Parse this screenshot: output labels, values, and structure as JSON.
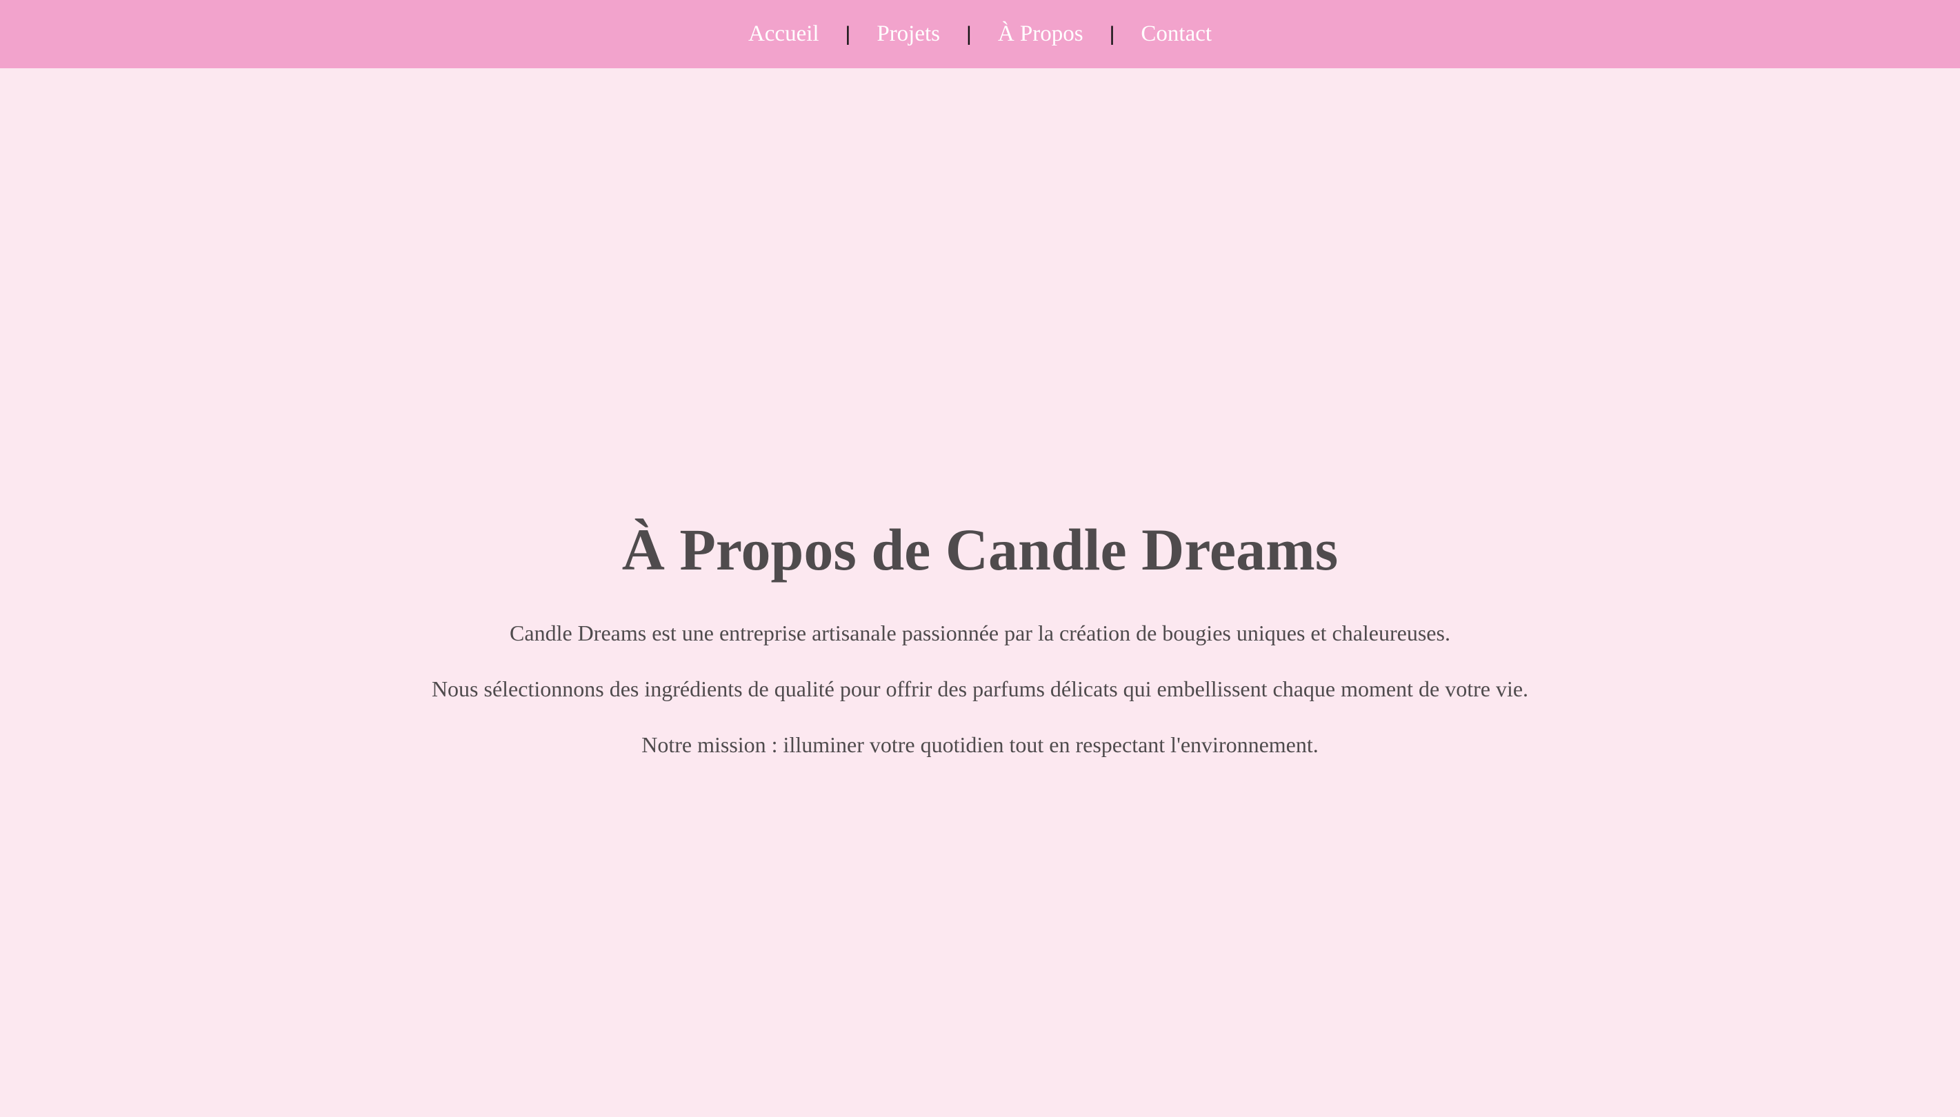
{
  "nav": {
    "items": [
      {
        "label": "Accueil"
      },
      {
        "label": "Projets"
      },
      {
        "label": "À Propos"
      },
      {
        "label": "Contact"
      }
    ],
    "separator": "|"
  },
  "about": {
    "title": "À Propos de Candle Dreams",
    "paragraphs": [
      "Candle Dreams est une entreprise artisanale passionnée par la création de bougies uniques et chaleureuses.",
      "Nous sélectionnons des ingrédients de qualité pour offrir des parfums délicats qui embellissent chaque moment de votre vie.",
      "Notre mission : illuminer votre quotidien tout en respectant l'environnement."
    ]
  },
  "colors": {
    "navbar_bg": "#f2a3cc",
    "page_bg": "#fce8f0",
    "text": "#4f4b4d",
    "nav_text": "#ffffff"
  }
}
